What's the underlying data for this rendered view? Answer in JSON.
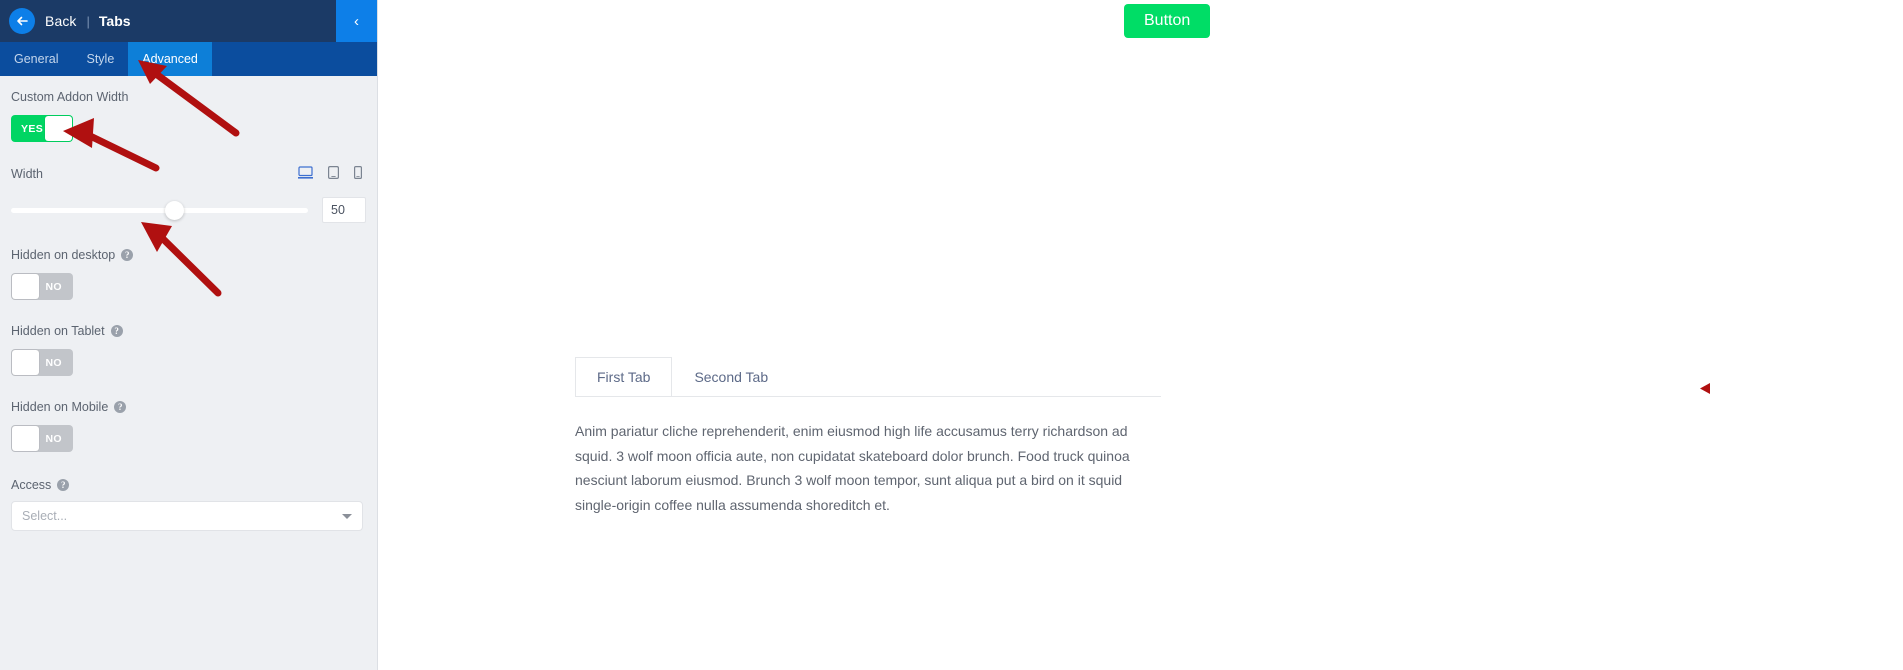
{
  "sidebar": {
    "header": {
      "back_icon": "arrow-left-icon",
      "back_label": "Back",
      "separator": "|",
      "title": "Tabs",
      "collapse_icon": "chevron-left-icon"
    },
    "tabs": [
      {
        "label": "General",
        "active": false
      },
      {
        "label": "Style",
        "active": false
      },
      {
        "label": "Advanced",
        "active": true
      }
    ],
    "fields": {
      "custom_addon_width": {
        "label": "Custom Addon Width",
        "toggle_value": "YES",
        "state": "on"
      },
      "width": {
        "label": "Width",
        "value": "50",
        "slider_percent": 50,
        "devices": [
          {
            "name": "desktop",
            "icon": "desktop-icon",
            "active": true
          },
          {
            "name": "tablet",
            "icon": "tablet-icon",
            "active": false
          },
          {
            "name": "mobile",
            "icon": "mobile-icon",
            "active": false
          }
        ]
      },
      "hidden_on_desktop": {
        "label": "Hidden on desktop",
        "help_icon": "question-mark-icon",
        "toggle_value": "NO",
        "state": "off"
      },
      "hidden_on_tablet": {
        "label": "Hidden on Tablet",
        "help_icon": "question-mark-icon",
        "toggle_value": "NO",
        "state": "off"
      },
      "hidden_on_mobile": {
        "label": "Hidden on Mobile",
        "help_icon": "question-mark-icon",
        "toggle_value": "NO",
        "state": "off"
      },
      "access": {
        "label": "Access",
        "help_icon": "question-mark-icon",
        "placeholder": "Select...",
        "value": "",
        "caret_icon": "chevron-down-icon"
      }
    }
  },
  "canvas": {
    "button": {
      "label": "Button"
    },
    "tabs_widget": {
      "tabs": [
        {
          "label": "First Tab",
          "active": true
        },
        {
          "label": "Second Tab",
          "active": false
        }
      ],
      "content": "Anim pariatur cliche reprehenderit, enim eiusmod high life accusamus terry richardson ad squid. 3 wolf moon officia aute, non cupidatat skateboard dolor brunch. Food truck quinoa nesciunt laborum eiusmod. Brunch 3 wolf moon tempor, sunt aliqua put a bird on it squid single-origin coffee nulla assumenda shoreditch et."
    },
    "marker_icon": "left-arrowhead-marker"
  },
  "annotations": {
    "arrow_to_advanced_tab": "arrow-icon",
    "arrow_to_toggle": "arrow-icon",
    "arrow_to_slider": "arrow-icon",
    "highlight_box_devices": "red-rectangle-highlight"
  },
  "colors": {
    "header_bg": "#1b3a66",
    "tabbar_bg": "#0b4d9e",
    "active_tab": "#0d7fd8",
    "panel_bg": "#eef0f3",
    "toggle_on": "#00d563",
    "toggle_off": "#c2c5ca",
    "button_green": "#00dd66",
    "annotation_red": "#b01010"
  }
}
